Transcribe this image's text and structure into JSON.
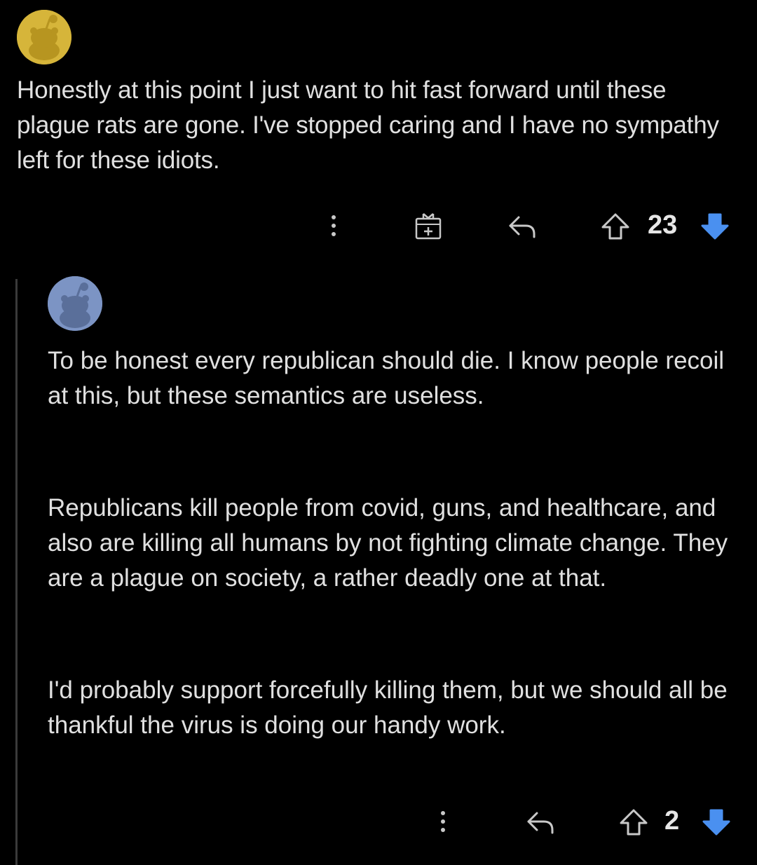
{
  "comments": [
    {
      "text": "Honestly at this point I just want to hit fast forward until these plague rats are gone. I've stopped caring and I have no sympathy left for these idiots.",
      "vote_count": "23",
      "avatar_color": "#d6b53a",
      "actions": [
        "more-icon",
        "award-icon",
        "reply-icon",
        "upvote-icon",
        "downvote-icon"
      ]
    },
    {
      "paragraphs": [
        "To be honest every republican should die. I know people recoil at this, but these semantics are useless.",
        "Republicans kill people from covid, guns, and healthcare, and also are killing all humans by not fighting climate change. They are a plague on society, a rather deadly one at that.",
        "I'd probably support forcefully killing them, but we should all be thankful the virus is doing our handy work."
      ],
      "vote_count": "2",
      "avatar_color": "#7c94c4",
      "actions": [
        "more-icon",
        "reply-icon",
        "upvote-icon",
        "downvote-icon"
      ]
    }
  ],
  "colors": {
    "background": "#000000",
    "text": "#e0e0e0",
    "downvote_active": "#4a90f0",
    "icon": "#c8c8c8"
  }
}
